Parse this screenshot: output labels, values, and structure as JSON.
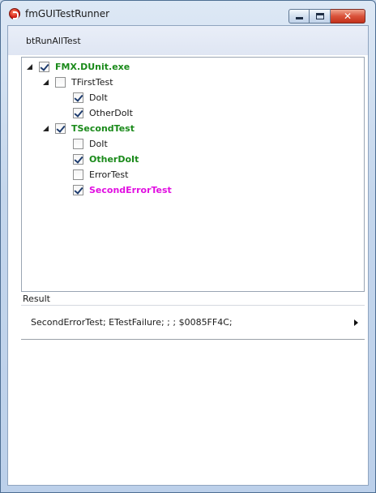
{
  "window": {
    "title": "fmGUITestRunner",
    "minimize_glyph": "",
    "maximize_glyph": "",
    "close_glyph": "✕"
  },
  "toolbar": {
    "run_all_label": "btRunAllTest"
  },
  "tree": {
    "root": {
      "label": "FMX.DUnit.exe",
      "checked": true,
      "color": "#1a8a1a"
    },
    "items": [
      {
        "label": "TFirstTest",
        "checked": false
      },
      {
        "label": "DoIt",
        "checked": true
      },
      {
        "label": "OtherDoIt",
        "checked": true
      },
      {
        "label": "TSecondTest",
        "checked": true,
        "color": "#1a8a1a"
      },
      {
        "label": "DoIt",
        "checked": false
      },
      {
        "label": "OtherDoIt",
        "checked": true,
        "color": "#1a8a1a"
      },
      {
        "label": "ErrorTest",
        "checked": false
      },
      {
        "label": "SecondErrorTest",
        "checked": true,
        "color": "#e10fe1"
      }
    ]
  },
  "result": {
    "label": "Result",
    "rows": [
      {
        "text": "SecondErrorTest; ETestFailure; ; ; $0085FF4C;"
      }
    ]
  }
}
